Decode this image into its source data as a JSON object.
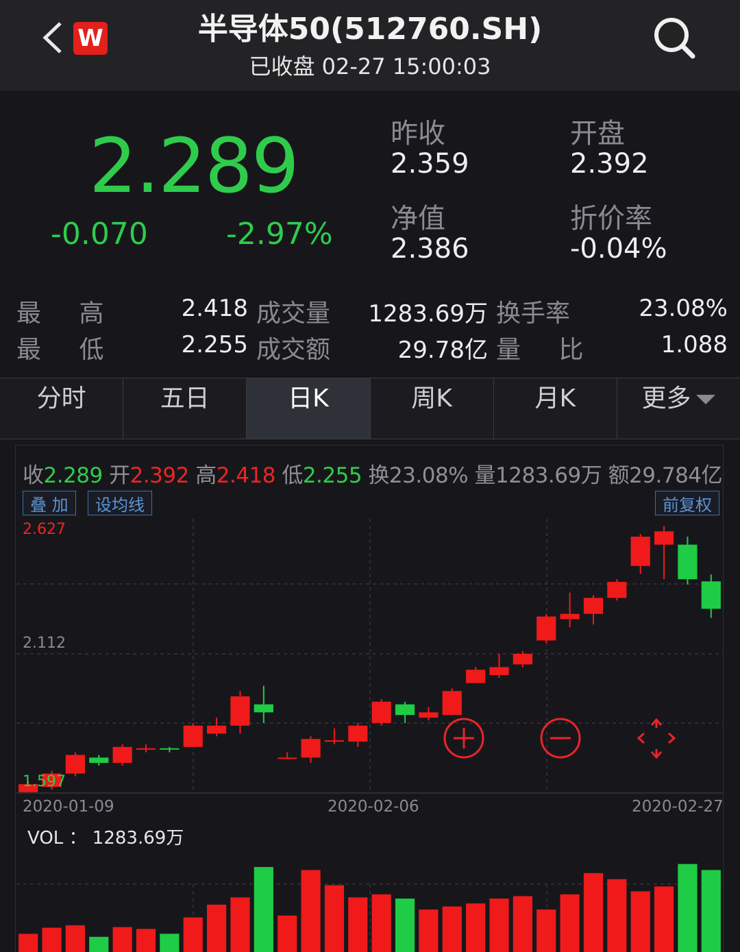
{
  "header": {
    "title": "半导体50(512760.SH)",
    "subtitle": "已收盘 02-27 15:00:03",
    "logo_letter": "W"
  },
  "quote": {
    "price": "2.289",
    "change": "-0.070",
    "change_pct": "-2.97%",
    "prev_close_label": "昨收",
    "prev_close": "2.359",
    "open_label": "开盘",
    "open": "2.392",
    "nav_label": "净值",
    "nav": "2.386",
    "discount_label": "折价率",
    "discount": "-0.04%"
  },
  "stats": {
    "high_label": "最 高",
    "high": "2.418",
    "low_label": "最 低",
    "low": "2.255",
    "volume_label": "成交量",
    "volume": "1283.69万",
    "amount_label": "成交额",
    "amount": "29.78亿",
    "turnover_label": "换手率",
    "turnover": "23.08%",
    "ratio_label": "量 比",
    "ratio": "1.088"
  },
  "tabs": [
    "分时",
    "五日",
    "日K",
    "周K",
    "月K",
    "更多"
  ],
  "active_tab": "日K",
  "chart_info": {
    "close_label": "收",
    "close": "2.289",
    "open_label": "开",
    "open": "2.392",
    "high_label": "高",
    "high": "2.418",
    "low_label": "低",
    "low": "2.255",
    "turnover": "换23.08%",
    "volume": "量1283.69万",
    "amount": "额29.784亿"
  },
  "chips": {
    "overlay": "叠 加",
    "ma": "设均线",
    "adjust": "前复权"
  },
  "axis": {
    "top": "2.627",
    "mid": "2.112",
    "bottom": "1.597"
  },
  "dates": {
    "start": "2020-01-09",
    "mid": "2020-02-06",
    "end": "2020-02-27"
  },
  "vol_text": "VOL ： 1283.69万",
  "colors": {
    "up": "#f01a1a",
    "down": "#1fcc45",
    "bg": "#17171b"
  },
  "chart_data": {
    "type": "candlestick",
    "ylim": [
      1.597,
      2.627
    ],
    "candles": [
      {
        "o": 1.6,
        "c": 1.63,
        "h": 1.64,
        "l": 1.6
      },
      {
        "o": 1.62,
        "c": 1.67,
        "h": 1.68,
        "l": 1.61
      },
      {
        "o": 1.67,
        "c": 1.74,
        "h": 1.75,
        "l": 1.66
      },
      {
        "o": 1.73,
        "c": 1.71,
        "h": 1.74,
        "l": 1.7
      },
      {
        "o": 1.71,
        "c": 1.77,
        "h": 1.78,
        "l": 1.7
      },
      {
        "o": 1.76,
        "c": 1.765,
        "h": 1.78,
        "l": 1.75
      },
      {
        "o": 1.765,
        "c": 1.76,
        "h": 1.77,
        "l": 1.75
      },
      {
        "o": 1.77,
        "c": 1.85,
        "h": 1.86,
        "l": 1.77
      },
      {
        "o": 1.82,
        "c": 1.85,
        "h": 1.88,
        "l": 1.81
      },
      {
        "o": 1.85,
        "c": 1.96,
        "h": 1.98,
        "l": 1.82
      },
      {
        "o": 1.93,
        "c": 1.9,
        "h": 2.0,
        "l": 1.86
      },
      {
        "o": 1.73,
        "c": 1.73,
        "h": 1.75,
        "l": 1.73
      },
      {
        "o": 1.73,
        "c": 1.8,
        "h": 1.81,
        "l": 1.71
      },
      {
        "o": 1.79,
        "c": 1.795,
        "h": 1.84,
        "l": 1.78
      },
      {
        "o": 1.79,
        "c": 1.85,
        "h": 1.86,
        "l": 1.77
      },
      {
        "o": 1.86,
        "c": 1.94,
        "h": 1.95,
        "l": 1.85
      },
      {
        "o": 1.93,
        "c": 1.89,
        "h": 1.94,
        "l": 1.86
      },
      {
        "o": 1.88,
        "c": 1.9,
        "h": 1.92,
        "l": 1.87
      },
      {
        "o": 1.89,
        "c": 1.98,
        "h": 1.99,
        "l": 1.89
      },
      {
        "o": 2.01,
        "c": 2.06,
        "h": 2.07,
        "l": 2.01
      },
      {
        "o": 2.04,
        "c": 2.07,
        "h": 2.12,
        "l": 2.03
      },
      {
        "o": 2.08,
        "c": 2.12,
        "h": 2.13,
        "l": 2.07
      },
      {
        "o": 2.17,
        "c": 2.26,
        "h": 2.27,
        "l": 2.16
      },
      {
        "o": 2.25,
        "c": 2.27,
        "h": 2.35,
        "l": 2.22
      },
      {
        "o": 2.27,
        "c": 2.33,
        "h": 2.34,
        "l": 2.23
      },
      {
        "o": 2.33,
        "c": 2.39,
        "h": 2.4,
        "l": 2.32
      },
      {
        "o": 2.45,
        "c": 2.56,
        "h": 2.57,
        "l": 2.42
      },
      {
        "o": 2.53,
        "c": 2.58,
        "h": 2.6,
        "l": 2.4
      },
      {
        "o": 2.53,
        "c": 2.4,
        "h": 2.56,
        "l": 2.38
      },
      {
        "o": 2.392,
        "c": 2.289,
        "h": 2.418,
        "l": 2.255
      }
    ],
    "volume_ylim": [
      0,
      140
    ],
    "volumes": [
      30,
      40,
      44,
      25,
      41,
      38,
      30,
      57,
      78,
      90,
      140,
      60,
      135,
      110,
      90,
      95,
      88,
      70,
      75,
      80,
      88,
      92,
      70,
      95,
      130,
      120,
      100,
      108,
      145,
      135
    ]
  }
}
